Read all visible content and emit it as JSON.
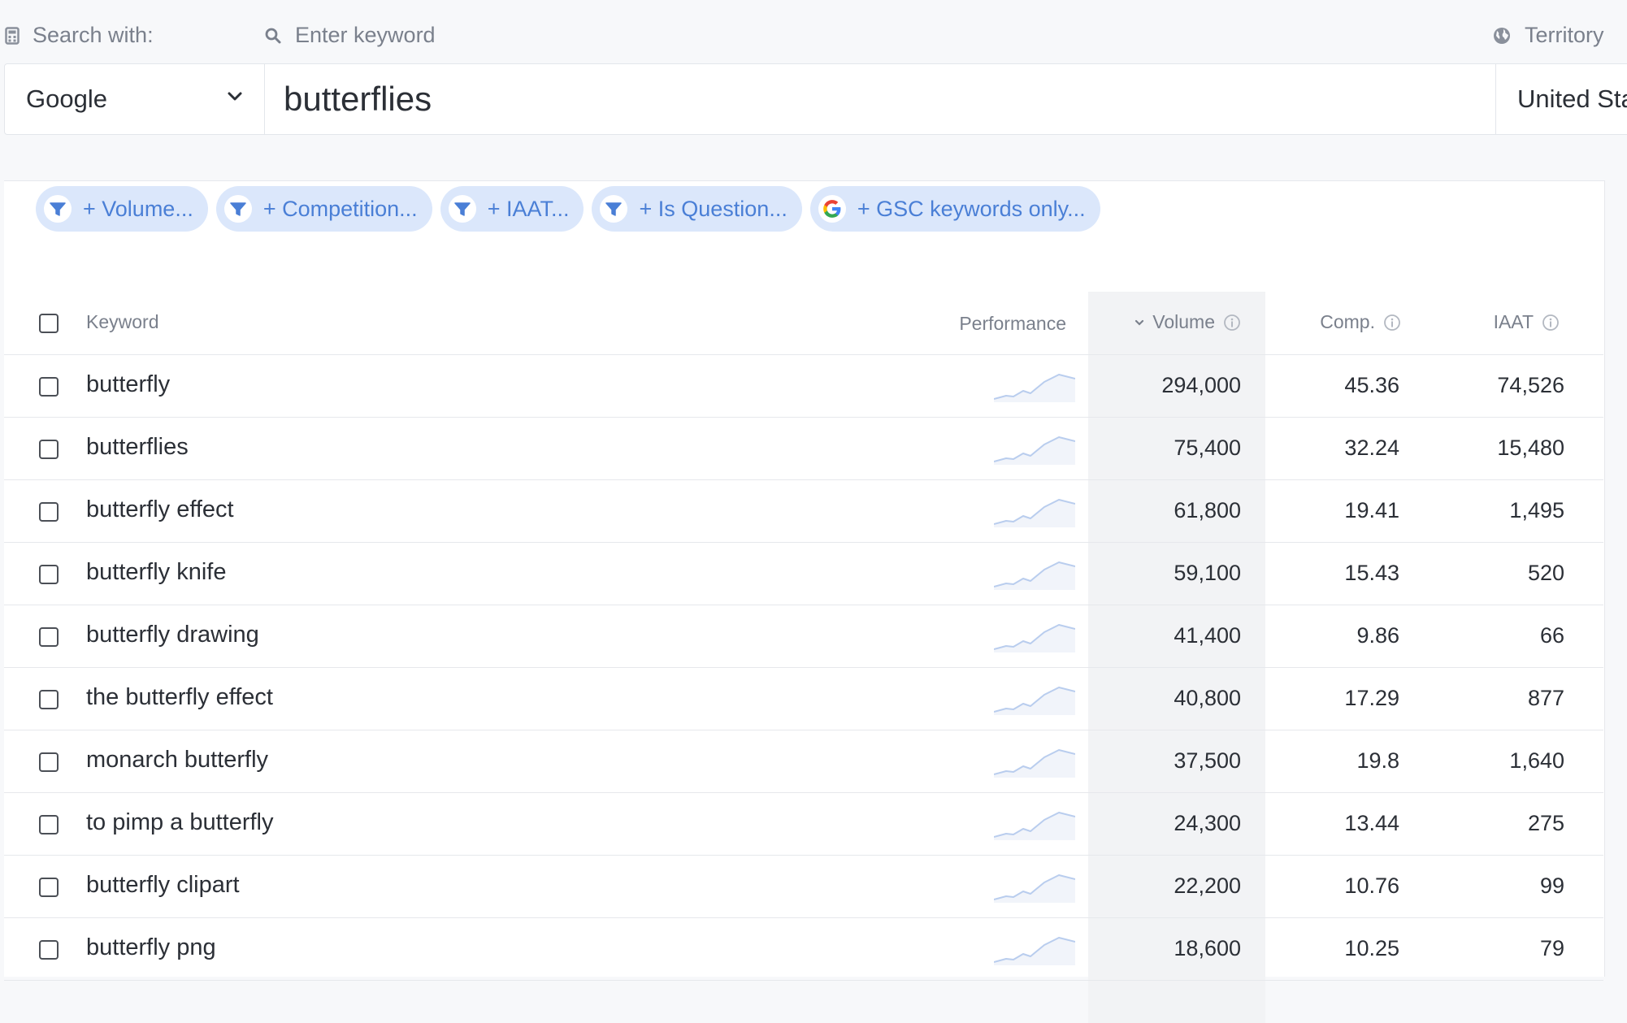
{
  "search": {
    "engine_label": "Search with:",
    "keyword_label": "Enter keyword",
    "territory_label": "Territory",
    "engine_value": "Google",
    "keyword_value": "butterflies",
    "territory_value": "United States"
  },
  "filters": [
    {
      "label": "+ Volume...",
      "icon": "filter-icon"
    },
    {
      "label": "+ Competition...",
      "icon": "filter-icon"
    },
    {
      "label": "+ IAAT...",
      "icon": "filter-icon"
    },
    {
      "label": "+ Is Question...",
      "icon": "filter-icon"
    },
    {
      "label": "+ GSC keywords only...",
      "icon": "google-icon"
    }
  ],
  "table": {
    "headers": {
      "keyword": "Keyword",
      "performance": "Performance",
      "volume": "Volume",
      "comp": "Comp.",
      "iaat": "IAAT"
    },
    "rows": [
      {
        "keyword": "butterfly",
        "volume": "294,000",
        "comp": "45.36",
        "iaat": "74,526"
      },
      {
        "keyword": "butterflies",
        "volume": "75,400",
        "comp": "32.24",
        "iaat": "15,480"
      },
      {
        "keyword": "butterfly effect",
        "volume": "61,800",
        "comp": "19.41",
        "iaat": "1,495"
      },
      {
        "keyword": "butterfly knife",
        "volume": "59,100",
        "comp": "15.43",
        "iaat": "520"
      },
      {
        "keyword": "butterfly drawing",
        "volume": "41,400",
        "comp": "9.86",
        "iaat": "66"
      },
      {
        "keyword": "the butterfly effect",
        "volume": "40,800",
        "comp": "17.29",
        "iaat": "877"
      },
      {
        "keyword": "monarch butterfly",
        "volume": "37,500",
        "comp": "19.8",
        "iaat": "1,640"
      },
      {
        "keyword": "to pimp a butterfly",
        "volume": "24,300",
        "comp": "13.44",
        "iaat": "275"
      },
      {
        "keyword": "butterfly clipart",
        "volume": "22,200",
        "comp": "10.76",
        "iaat": "99"
      },
      {
        "keyword": "butterfly png",
        "volume": "18,600",
        "comp": "10.25",
        "iaat": "79"
      }
    ]
  },
  "colors": {
    "chip_bg": "#dbe7fb",
    "chip_text": "#4a7fd6",
    "sparkline": "#b9cdee"
  }
}
